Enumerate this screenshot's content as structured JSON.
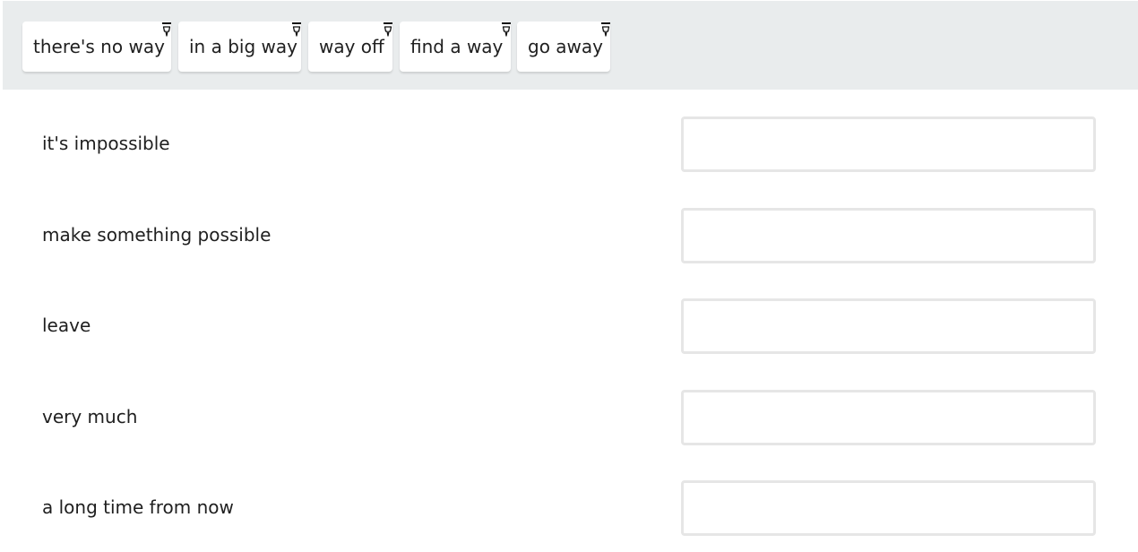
{
  "chips": [
    {
      "label": "there's no way",
      "icon": "drag-pin-icon"
    },
    {
      "label": "in a big way",
      "icon": "drag-pin-icon"
    },
    {
      "label": "way off",
      "icon": "drag-pin-icon"
    },
    {
      "label": "find a way",
      "icon": "drag-pin-icon"
    },
    {
      "label": "go away",
      "icon": "drag-pin-icon"
    }
  ],
  "rows": [
    {
      "label": "it's impossible",
      "answer": ""
    },
    {
      "label": "make something possible",
      "answer": ""
    },
    {
      "label": "leave",
      "answer": ""
    },
    {
      "label": "very much",
      "answer": ""
    },
    {
      "label": "a long time from now",
      "answer": ""
    }
  ],
  "colors": {
    "bank_background": "#e9eced",
    "chip_background": "#ffffff",
    "drop_zone_border": "#e6e6e6"
  }
}
